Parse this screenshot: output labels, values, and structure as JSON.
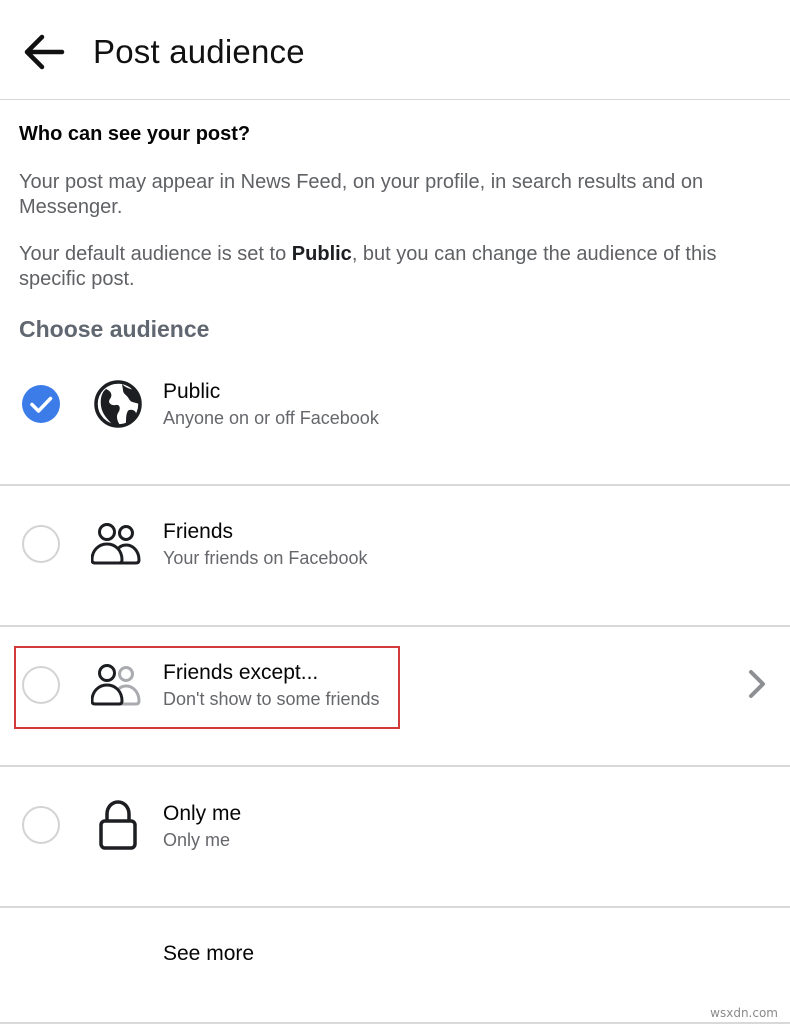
{
  "header": {
    "title": "Post audience",
    "back_icon": "arrow-left-icon"
  },
  "intro": {
    "heading": "Who can see your post?",
    "paragraph1": "Your post may appear in News Feed, on your profile, in search results and on Messenger.",
    "paragraph2_before": "Your default audience is set to ",
    "paragraph2_bold": "Public",
    "paragraph2_after": ", but you can change the audience of this specific post."
  },
  "choose_label": "Choose audience",
  "options": [
    {
      "title": "Public",
      "subtitle": "Anyone on or off Facebook",
      "icon": "globe-icon",
      "selected": true
    },
    {
      "title": "Friends",
      "subtitle": "Your friends on Facebook",
      "icon": "friends-icon",
      "selected": false
    },
    {
      "title": "Friends except...",
      "subtitle": "Don't show to some friends",
      "icon": "friends-except-icon",
      "selected": false,
      "has_chevron": true
    },
    {
      "title": "Only me",
      "subtitle": "Only me",
      "icon": "lock-icon",
      "selected": false
    }
  ],
  "see_more": "See more",
  "watermark": "wsxdn.com",
  "colors": {
    "accent": "#3b7ce8",
    "highlight": "#d23a3a",
    "secondary_text": "#65676b"
  }
}
